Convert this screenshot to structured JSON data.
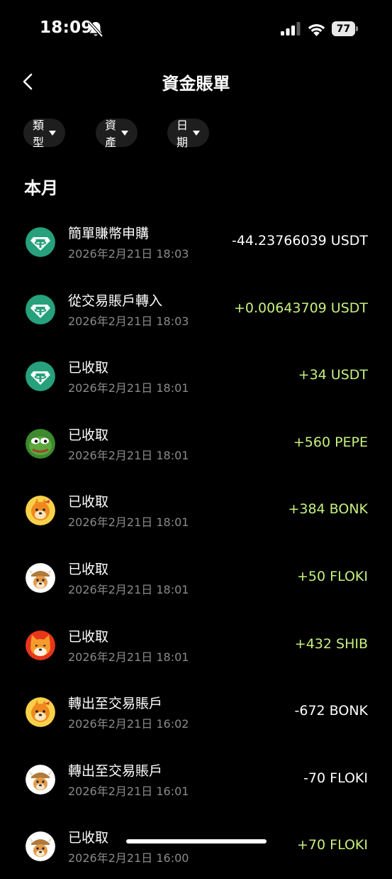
{
  "status": {
    "time": "18:09",
    "battery": "77"
  },
  "nav": {
    "title": "資金賬單"
  },
  "filters": [
    {
      "label": "類型"
    },
    {
      "label": "資產"
    },
    {
      "label": "日期"
    }
  ],
  "section": {
    "title": "本月"
  },
  "colors": {
    "positive": "#c6f17e",
    "negative": "#ffffff",
    "secondary": "#8a8a8a",
    "chip": "#1e1e1e"
  },
  "transactions": [
    {
      "title": "簡單賺幣申購",
      "time": "2026年2月21日 18:03",
      "amount": "-44.23766039 USDT",
      "icon": "usdt-icon",
      "positive": false
    },
    {
      "title": "從交易賬戶轉入",
      "time": "2026年2月21日 18:03",
      "amount": "+0.00643709 USDT",
      "icon": "usdt-icon",
      "positive": true
    },
    {
      "title": "已收取",
      "time": "2026年2月21日 18:01",
      "amount": "+34 USDT",
      "icon": "usdt-icon",
      "positive": true
    },
    {
      "title": "已收取",
      "time": "2026年2月21日 18:01",
      "amount": "+560 PEPE",
      "icon": "pepe-icon",
      "positive": true
    },
    {
      "title": "已收取",
      "time": "2026年2月21日 18:01",
      "amount": "+384 BONK",
      "icon": "bonk-icon",
      "positive": true
    },
    {
      "title": "已收取",
      "time": "2026年2月21日 18:01",
      "amount": "+50 FLOKI",
      "icon": "floki-icon",
      "positive": true
    },
    {
      "title": "已收取",
      "time": "2026年2月21日 18:01",
      "amount": "+432 SHIB",
      "icon": "shib-icon",
      "positive": true
    },
    {
      "title": "轉出至交易賬戶",
      "time": "2026年2月21日 16:02",
      "amount": "-672 BONK",
      "icon": "bonk-icon",
      "positive": false
    },
    {
      "title": "轉出至交易賬戶",
      "time": "2026年2月21日 16:01",
      "amount": "-70 FLOKI",
      "icon": "floki-icon",
      "positive": false
    },
    {
      "title": "已收取",
      "time": "2026年2月21日 16:00",
      "amount": "+70 FLOKI",
      "icon": "floki-icon",
      "positive": true
    }
  ]
}
